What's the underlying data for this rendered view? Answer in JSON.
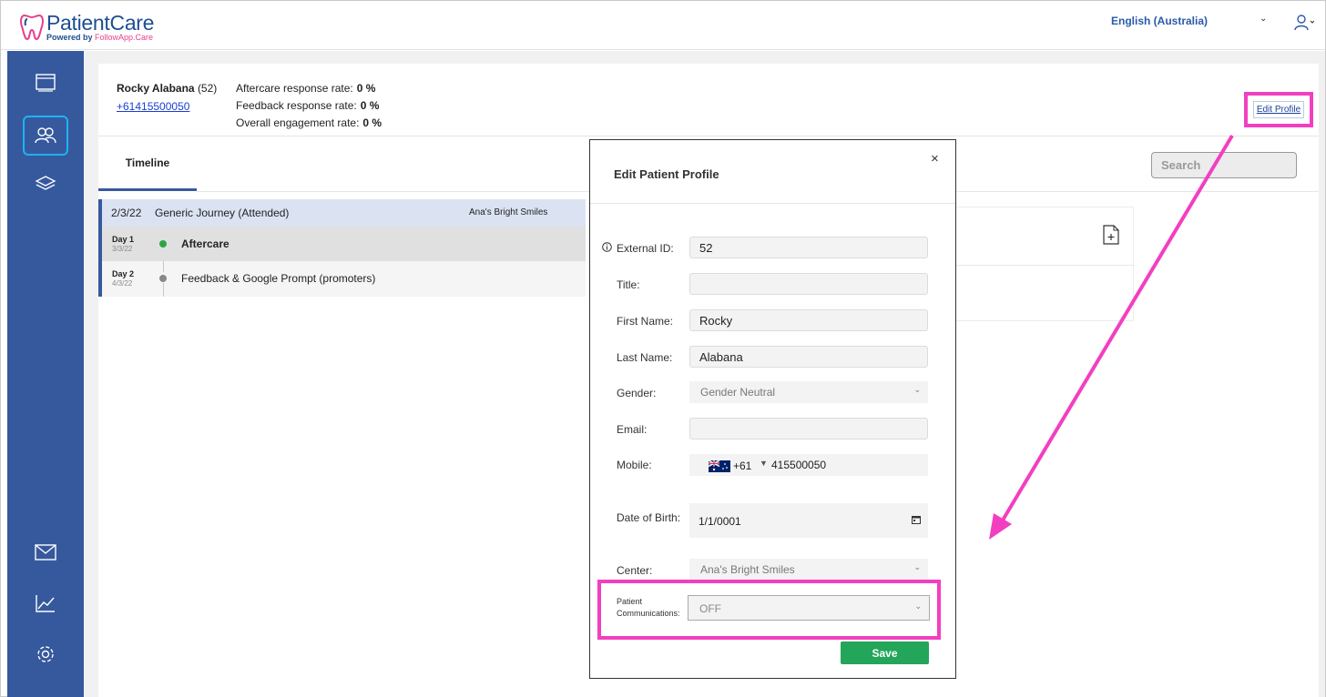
{
  "brand": {
    "title": "PatientCare",
    "subtitle_prefix": "Powered by ",
    "subtitle_brand": "FollowApp.Care"
  },
  "header": {
    "language": "English (Australia)"
  },
  "patient": {
    "name": "Rocky Alabana",
    "age": "(52)",
    "phone": "+61415500050",
    "stats": [
      {
        "label": "Aftercare response rate:",
        "value": "0 %"
      },
      {
        "label": "Feedback response rate:",
        "value": "0 %"
      },
      {
        "label": "Overall engagement rate:",
        "value": "0 %"
      }
    ],
    "edit_profile_label": "Edit Profile"
  },
  "tabs": {
    "timeline": "Timeline"
  },
  "search": {
    "placeholder": "Search"
  },
  "timeline": {
    "journey": {
      "date": "2/3/22",
      "name": "Generic Journey (Attended)",
      "center": "Ana's Bright Smiles"
    },
    "days": [
      {
        "day": "Day 1",
        "date": "3/3/22",
        "task": "Aftercare"
      },
      {
        "day": "Day 2",
        "date": "4/3/22",
        "task": "Feedback & Google Prompt (promoters)"
      }
    ]
  },
  "modal": {
    "title": "Edit Patient Profile",
    "close": "×",
    "fields": {
      "external_id": {
        "label": "External ID:",
        "value": "52"
      },
      "title": {
        "label": "Title:",
        "value": ""
      },
      "first_name": {
        "label": "First Name:",
        "value": "Rocky"
      },
      "last_name": {
        "label": "Last Name:",
        "value": "Alabana"
      },
      "gender": {
        "label": "Gender:",
        "value": "Gender Neutral"
      },
      "email": {
        "label": "Email:",
        "value": ""
      },
      "mobile": {
        "label": "Mobile:",
        "dial_code": "+61",
        "number": "415500050"
      },
      "dob": {
        "label": "Date of Birth:",
        "value": "1/1/0001"
      },
      "center": {
        "label": "Center:",
        "value": "Ana's Bright Smiles"
      },
      "patient_comms": {
        "label_line1": "Patient",
        "label_line2": "Communications:",
        "value": "OFF"
      }
    },
    "save_label": "Save"
  },
  "colors": {
    "sidebar": "#36599e",
    "highlight": "#f23fc1",
    "save": "#23a55a",
    "active_nav": "#1eb3ee"
  }
}
